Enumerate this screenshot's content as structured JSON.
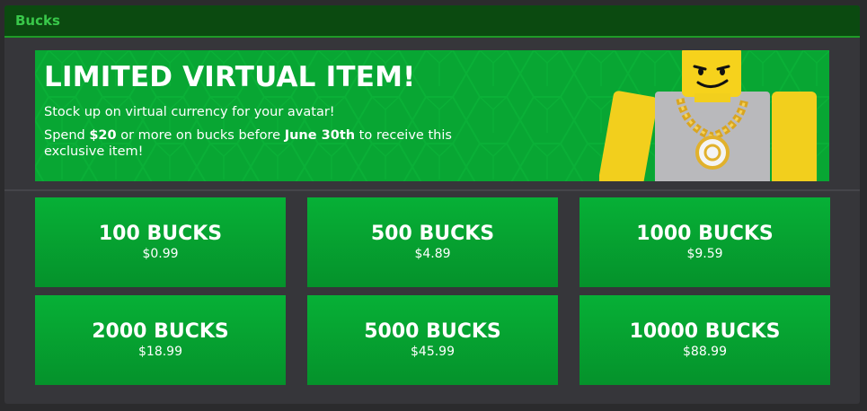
{
  "window": {
    "title": "Bucks"
  },
  "banner": {
    "headline": "LIMITED VIRTUAL ITEM!",
    "line1": "Stock up on virtual currency for your avatar!",
    "line2_pre": "Spend ",
    "line2_amount": "$20",
    "line2_mid": " or more on bucks before ",
    "line2_date": "June 30th",
    "line2_post": " to receive this exclusive item!",
    "avatar_icon": "blocky-avatar-with-gold-chain"
  },
  "packages": [
    {
      "amount": "100 BUCKS",
      "price": "$0.99"
    },
    {
      "amount": "500 BUCKS",
      "price": "$4.89"
    },
    {
      "amount": "1000 BUCKS",
      "price": "$9.59"
    },
    {
      "amount": "2000 BUCKS",
      "price": "$18.99"
    },
    {
      "amount": "5000 BUCKS",
      "price": "$45.99"
    },
    {
      "amount": "10000 BUCKS",
      "price": "$88.99"
    }
  ],
  "colors": {
    "accent": "#08a633",
    "titlebar": "#0b4a10",
    "title_text": "#39c84a"
  }
}
